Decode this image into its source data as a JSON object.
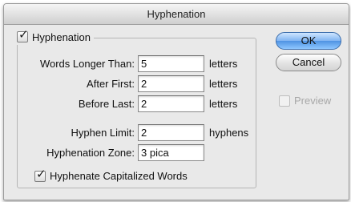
{
  "dialog": {
    "title": "Hyphenation"
  },
  "hyphenation": {
    "enabled": true,
    "label": "Hyphenation"
  },
  "fields": {
    "words_longer_than": {
      "label": "Words Longer Than:",
      "value": "5",
      "unit": "letters"
    },
    "after_first": {
      "label": "After First:",
      "value": "2",
      "unit": "letters"
    },
    "before_last": {
      "label": "Before Last:",
      "value": "2",
      "unit": "letters"
    },
    "hyphen_limit": {
      "label": "Hyphen Limit:",
      "value": "2",
      "unit": "hyphens"
    },
    "hyphenation_zone": {
      "label": "Hyphenation Zone:",
      "value": "3 pica"
    }
  },
  "capitalized": {
    "checked": true,
    "label": "Hyphenate Capitalized Words"
  },
  "buttons": {
    "ok": "OK",
    "cancel": "Cancel"
  },
  "preview": {
    "label": "Preview",
    "checked": false,
    "enabled": false
  },
  "colors": {
    "default_button": "#6aa8ef",
    "dialog_background": "#e9e9e9"
  }
}
